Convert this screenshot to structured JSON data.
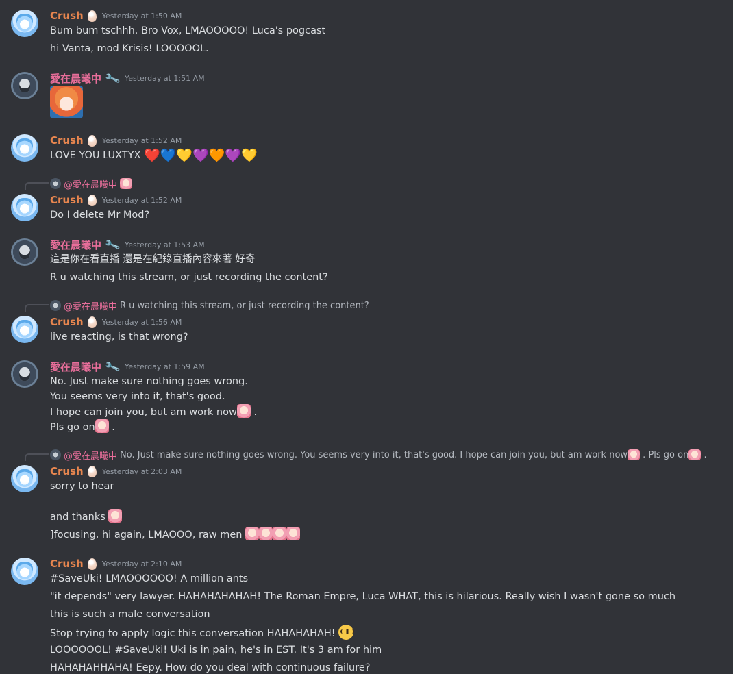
{
  "messages": [
    {
      "author": "Crush",
      "author_class": "crush",
      "timestamp": "Yesterday at 1:50 AM",
      "lines": [
        "Bum bum tschhh. Bro Vox, LMAOOOOO! Luca's pogcast",
        "hi Vanta, mod Krisis! LOOOOOL."
      ]
    },
    {
      "author": "愛在晨曦中",
      "author_class": "ai",
      "timestamp": "Yesterday at 1:51 AM",
      "attachment": "image"
    },
    {
      "author": "Crush",
      "author_class": "crush",
      "timestamp": "Yesterday at 1:52 AM",
      "lines": [
        "LOVE YOU LUXTYX"
      ],
      "hearts": [
        "❤️",
        "💙",
        "💛",
        "💜",
        "🧡",
        "💜",
        "💛"
      ]
    },
    {
      "reply_to": "@愛在晨曦中",
      "author": "Crush",
      "author_class": "crush",
      "timestamp": "Yesterday at 1:52 AM",
      "lines": [
        "Do I delete Mr Mod?"
      ]
    },
    {
      "author": "愛在晨曦中",
      "author_class": "ai",
      "timestamp": "Yesterday at 1:53 AM",
      "lines": [
        "這是你在看直播 還是在紀錄直播內容來著 好奇",
        "R u watching this stream, or just recording the content?"
      ]
    },
    {
      "reply_to": "@愛在晨曦中",
      "reply_text": "R u watching this stream, or just recording the content?",
      "author": "Crush",
      "author_class": "crush",
      "timestamp": "Yesterday at 1:56 AM",
      "lines": [
        "live reacting, is that wrong?"
      ]
    },
    {
      "author": "愛在晨曦中",
      "author_class": "ai",
      "timestamp": "Yesterday at 1:59 AM",
      "lines": [
        "No. Just make sure nothing goes wrong.",
        "You seems very into it, that's good.",
        "I hope can join you, but am work now",
        "Pls go on"
      ]
    },
    {
      "reply_to": "@愛在晨曦中",
      "reply_text": "No. Just make sure nothing goes wrong. You seems very into it, that's good. I hope can join you, but am work now",
      "reply_text_tail": "Pls go on",
      "author": "Crush",
      "author_class": "crush",
      "timestamp": "Yesterday at 2:03 AM",
      "lines": [
        "sorry to hear",
        "and thanks",
        "]focusing, hi again, LMAOOO, raw men"
      ]
    },
    {
      "author": "Crush",
      "author_class": "crush",
      "timestamp": "Yesterday at 2:10 AM",
      "lines": [
        "#SaveUki! LMAOOOOOO! A million ants",
        "\"it depends\" very lawyer. HAHAHAHAHAH! The Roman Empre, Luca WHAT, this is hilarious. Really wish I wasn't gone so much",
        "this is such a male conversation",
        "Stop trying to apply logic this conversation HAHAHAHAH!",
        "LOOOOOOL! #SaveUki! Uki is in pain, he's in EST. It's 3 am for him",
        "HAHAHAHHAHA! Eepy. How do you deal with continuous failure?"
      ]
    }
  ]
}
